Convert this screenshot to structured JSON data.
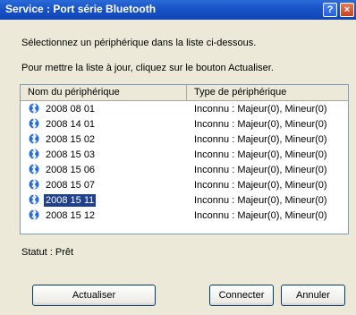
{
  "window": {
    "title": "Service : Port série Bluetooth",
    "help_label": "?",
    "close_label": "×"
  },
  "instructions": {
    "line1": "Sélectionnez un périphérique dans la liste ci-dessous.",
    "line2": "Pour mettre la liste à jour, cliquez sur le bouton Actualiser."
  },
  "list": {
    "col_name": "Nom du périphérique",
    "col_type": "Type de périphérique",
    "rows": [
      {
        "name": "2008 08 01",
        "type": "Inconnu : Majeur(0), Mineur(0)"
      },
      {
        "name": "2008 14 01",
        "type": "Inconnu : Majeur(0), Mineur(0)"
      },
      {
        "name": "2008 15 02",
        "type": "Inconnu : Majeur(0), Mineur(0)"
      },
      {
        "name": "2008 15 03",
        "type": "Inconnu : Majeur(0), Mineur(0)"
      },
      {
        "name": "2008 15 06",
        "type": "Inconnu : Majeur(0), Mineur(0)"
      },
      {
        "name": "2008 15 07",
        "type": "Inconnu : Majeur(0), Mineur(0)"
      },
      {
        "name": "2008 15 11",
        "type": "Inconnu : Majeur(0), Mineur(0)"
      },
      {
        "name": "2008 15 12",
        "type": "Inconnu : Majeur(0), Mineur(0)"
      }
    ],
    "selected_row": "2008 15 11",
    "icon": "bluetooth-device-icon"
  },
  "status": {
    "text": "Statut : Prêt"
  },
  "buttons": {
    "refresh": "Actualiser",
    "connect": "Connecter",
    "cancel": "Annuler"
  }
}
